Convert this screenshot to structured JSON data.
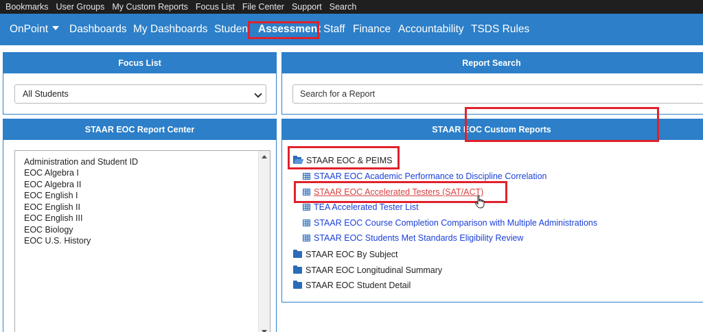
{
  "top_links": [
    "Bookmarks",
    "User Groups",
    "My Custom Reports",
    "Focus List",
    "File Center",
    "Support",
    "Search"
  ],
  "nav": {
    "brand": "OnPoint",
    "items": [
      "Dashboards",
      "My Dashboards",
      "Studen",
      "Assessment",
      "Staff",
      "Finance",
      "Accountability",
      "TSDS Rules"
    ],
    "active": "Assessment"
  },
  "focus_list": {
    "title": "Focus List",
    "selected": "All Students"
  },
  "report_search": {
    "title": "Report Search",
    "placeholder": "Search for a Report"
  },
  "report_center": {
    "title": "STAAR EOC Report Center",
    "items": [
      "Administration and Student ID",
      "EOC Algebra I",
      "EOC Algebra II",
      "EOC English I",
      "EOC English II",
      "EOC English III",
      "EOC Biology",
      "EOC U.S. History"
    ]
  },
  "custom_reports": {
    "title": "STAAR EOC Custom Reports",
    "open_folder": "STAAR EOC & PEIMS",
    "reports": [
      "STAAR EOC Academic Performance to Discipline Correlation",
      "STAAR EOC Accelerated Testers (SAT/ACT)",
      "TEA Accelerated Tester List",
      "STAAR EOC Course Completion Comparison with Multiple Administrations",
      "STAAR EOC Students Met Standards Eligibility Review"
    ],
    "folders": [
      "STAAR EOC By Subject",
      "STAAR EOC Longitudinal Summary",
      "STAAR EOC Student Detail"
    ]
  },
  "colors": {
    "brand_blue": "#2c7fc8",
    "highlight_red": "#e0212c",
    "link_blue": "#1a3fd9",
    "visited_red": "#d84040"
  }
}
